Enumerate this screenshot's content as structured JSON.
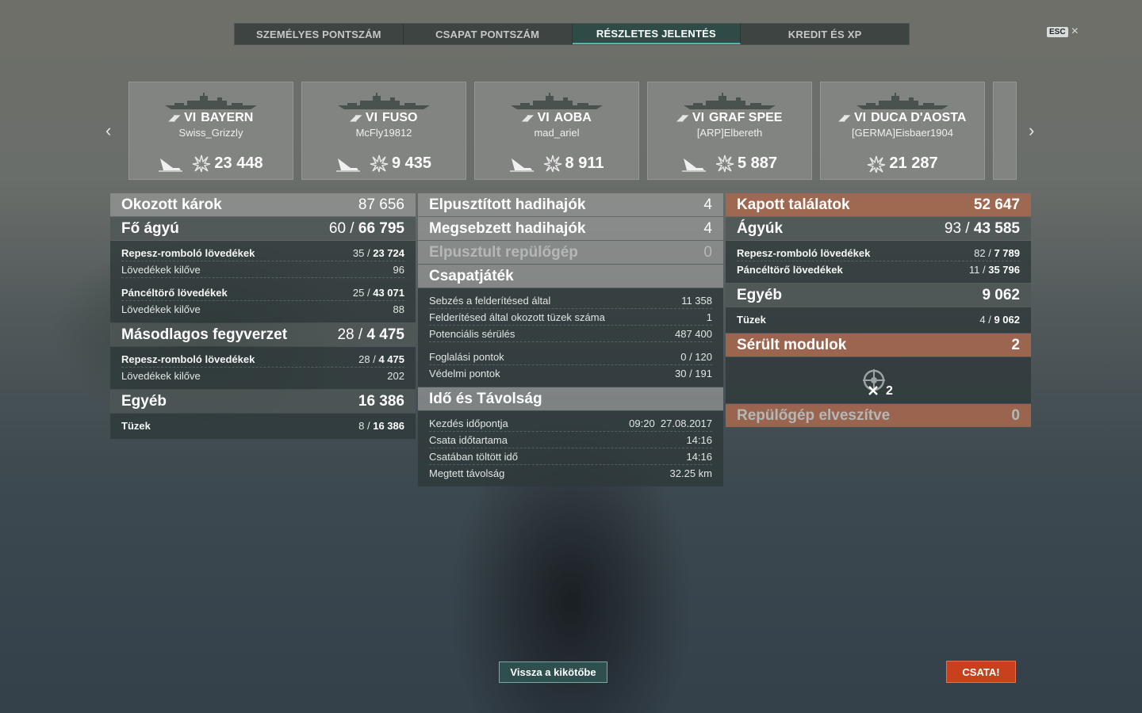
{
  "tabs": [
    "SZEMÉLYES PONTSZÁM",
    "CSAPAT PONTSZÁM",
    "RÉSZLETES JELENTÉS",
    "KREDIT ÉS XP"
  ],
  "active_tab_index": 2,
  "esc": {
    "key": "ESC",
    "close": "×"
  },
  "nav": {
    "prev": "‹",
    "next": "›"
  },
  "ships": [
    {
      "tier": "VI",
      "name": "BAYERN",
      "player": "Swiss_Grizzly",
      "damage": "23 448",
      "has_sink_icon": true
    },
    {
      "tier": "VI",
      "name": "FUSO",
      "player": "McFly19812",
      "damage": "9 435",
      "has_sink_icon": true
    },
    {
      "tier": "VI",
      "name": "AOBA",
      "player": "mad_ariel",
      "damage": "8 911",
      "has_sink_icon": true
    },
    {
      "tier": "VI",
      "name": "GRAF SPEE",
      "player": "[ARP]Elbereth",
      "damage": "5 887",
      "has_sink_icon": true
    },
    {
      "tier": "VI",
      "name": "DUCA D'AOSTA",
      "player": "[GERMA]Eisbaer1904",
      "damage": "21 287",
      "has_sink_icon": false
    }
  ],
  "damage": {
    "title": "Okozott károk",
    "total": "87 656",
    "main": {
      "title": "Fő ágyú",
      "hits": "60",
      "value": "66 795"
    },
    "main_rows": [
      {
        "label": "Repesz-romboló lövedékek",
        "hits": "35",
        "value": "23 724"
      },
      {
        "label": "Lövedékek kilőve",
        "value": "96"
      },
      {
        "label": "Páncéltörő lövedékek",
        "hits": "25",
        "value": "43 071"
      },
      {
        "label": "Lövedékek kilőve",
        "value": "88"
      }
    ],
    "secondary": {
      "title": "Másodlagos fegyverzet",
      "hits": "28",
      "value": "4 475"
    },
    "secondary_rows": [
      {
        "label": "Repesz-romboló lövedékek",
        "hits": "28",
        "value": "4 475"
      },
      {
        "label": "Lövedékek kilőve",
        "value": "202"
      }
    ],
    "other": {
      "title": "Egyéb",
      "value": "16 386"
    },
    "other_rows": [
      {
        "label": "Tüzek",
        "hits": "8",
        "value": "16 386"
      }
    ]
  },
  "middle": {
    "destroyed": {
      "label": "Elpusztított hadihajók",
      "value": "4"
    },
    "damaged": {
      "label": "Megsebzett hadihajók",
      "value": "4"
    },
    "planes": {
      "label": "Elpusztult repülőgép",
      "value": "0"
    },
    "teamplay": {
      "title": "Csapatjáték"
    },
    "team_rows": [
      {
        "label": "Sebzés a felderítésed által",
        "value": "11 358"
      },
      {
        "label": "Felderítésed által okozott tüzek száma",
        "value": "1"
      },
      {
        "label": "Potenciális sérülés",
        "value": "487 400"
      }
    ],
    "capture_rows": [
      {
        "label": "Foglalási pontok",
        "value": "0 / 120"
      },
      {
        "label": "Védelmi pontok",
        "value": "30 / 191"
      }
    ],
    "time": {
      "title": "Idő és Távolság"
    },
    "time_rows": [
      {
        "label": "Kezdés időpontja",
        "value": "09:20  27.08.2017"
      },
      {
        "label": "Csata időtartama",
        "value": "14:16"
      },
      {
        "label": "Csatában töltött idő",
        "value": "14:16"
      },
      {
        "label": "Megtett távolság",
        "value": "32.25 km"
      }
    ]
  },
  "received": {
    "title": "Kapott találatok",
    "total": "52 647",
    "guns": {
      "title": "Ágyúk",
      "hits": "93",
      "value": "43 585"
    },
    "gun_rows": [
      {
        "label": "Repesz-romboló lövedékek",
        "hits": "82",
        "value": "7 789"
      },
      {
        "label": "Páncéltörő lövedékek",
        "hits": "11",
        "value": "35 796"
      }
    ],
    "other": {
      "title": "Egyéb",
      "value": "9 062"
    },
    "other_rows": [
      {
        "label": "Tüzek",
        "hits": "4",
        "value": "9 062"
      }
    ],
    "modules": {
      "title": "Sérült modulok",
      "value": "2",
      "icon_count": "2"
    },
    "planes_lost": {
      "title": "Repülőgép elveszítve",
      "value": "0"
    }
  },
  "buttons": {
    "back": "Vissza a kikötőbe",
    "battle": "CSATA!"
  },
  "colors": {
    "active_tab": "#2f4b48",
    "accent": "#55b8a8",
    "received_header": "#a6684e",
    "battle_button": "#c8401c"
  }
}
